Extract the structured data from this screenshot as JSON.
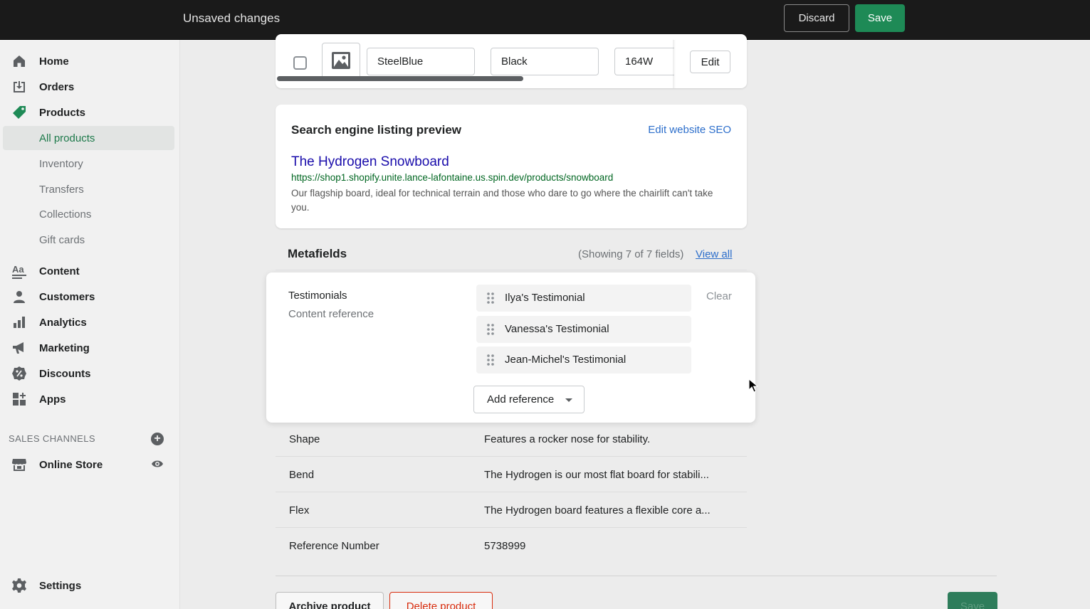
{
  "topbar": {
    "title": "Unsaved changes",
    "discard_label": "Discard",
    "save_label": "Save"
  },
  "sidebar": {
    "items": [
      {
        "label": "Home",
        "icon": "home-icon"
      },
      {
        "label": "Orders",
        "icon": "orders-icon"
      },
      {
        "label": "Products",
        "icon": "tag-icon"
      }
    ],
    "product_subitems": [
      {
        "label": "All products",
        "active": true
      },
      {
        "label": "Inventory"
      },
      {
        "label": "Transfers"
      },
      {
        "label": "Collections"
      },
      {
        "label": "Gift cards"
      }
    ],
    "items2": [
      {
        "label": "Content",
        "icon": "content-icon"
      },
      {
        "label": "Customers",
        "icon": "person-icon"
      },
      {
        "label": "Analytics",
        "icon": "bar-chart-icon"
      },
      {
        "label": "Marketing",
        "icon": "megaphone-icon"
      },
      {
        "label": "Discounts",
        "icon": "discount-icon"
      },
      {
        "label": "Apps",
        "icon": "apps-icon"
      }
    ],
    "sales_channels_heading": "SALES CHANNELS",
    "online_store_label": "Online Store",
    "settings_label": "Settings"
  },
  "variant_row": {
    "color": "SteelBlue",
    "binding": "Black",
    "size": "164W",
    "edit_label": "Edit"
  },
  "seo": {
    "heading": "Search engine listing preview",
    "edit_link": "Edit website SEO",
    "page_title": "The Hydrogen Snowboard",
    "url": "https://shop1.shopify.unite.lance-lafontaine.us.spin.dev/products/snowboard",
    "description": "Our flagship board, ideal for technical terrain and those who dare to go where the chairlift can't take you."
  },
  "metafields": {
    "heading": "Metafields",
    "count_text": "(Showing 7 of 7 fields)",
    "view_all": "View all",
    "testimonials": {
      "name": "Testimonials",
      "type": "Content reference",
      "references": [
        "Ilya's Testimonial",
        "Vanessa's Testimonial",
        "Jean-Michel's Testimonial"
      ],
      "clear_label": "Clear",
      "add_reference_label": "Add reference"
    },
    "rows": [
      {
        "key": "Shape",
        "value": "Features a rocker nose for stability."
      },
      {
        "key": "Bend",
        "value": "The Hydrogen is our most flat board for stabili..."
      },
      {
        "key": "Flex",
        "value": "The Hydrogen board features a flexible core a..."
      },
      {
        "key": "Reference Number",
        "value": "5738999"
      }
    ]
  },
  "footer": {
    "archive_label": "Archive product",
    "delete_label": "Delete product",
    "save_label": "Save"
  },
  "colors": {
    "accent_green": "#1e8a56",
    "link_blue": "#2c6ecb",
    "danger_red": "#d82c0d"
  }
}
